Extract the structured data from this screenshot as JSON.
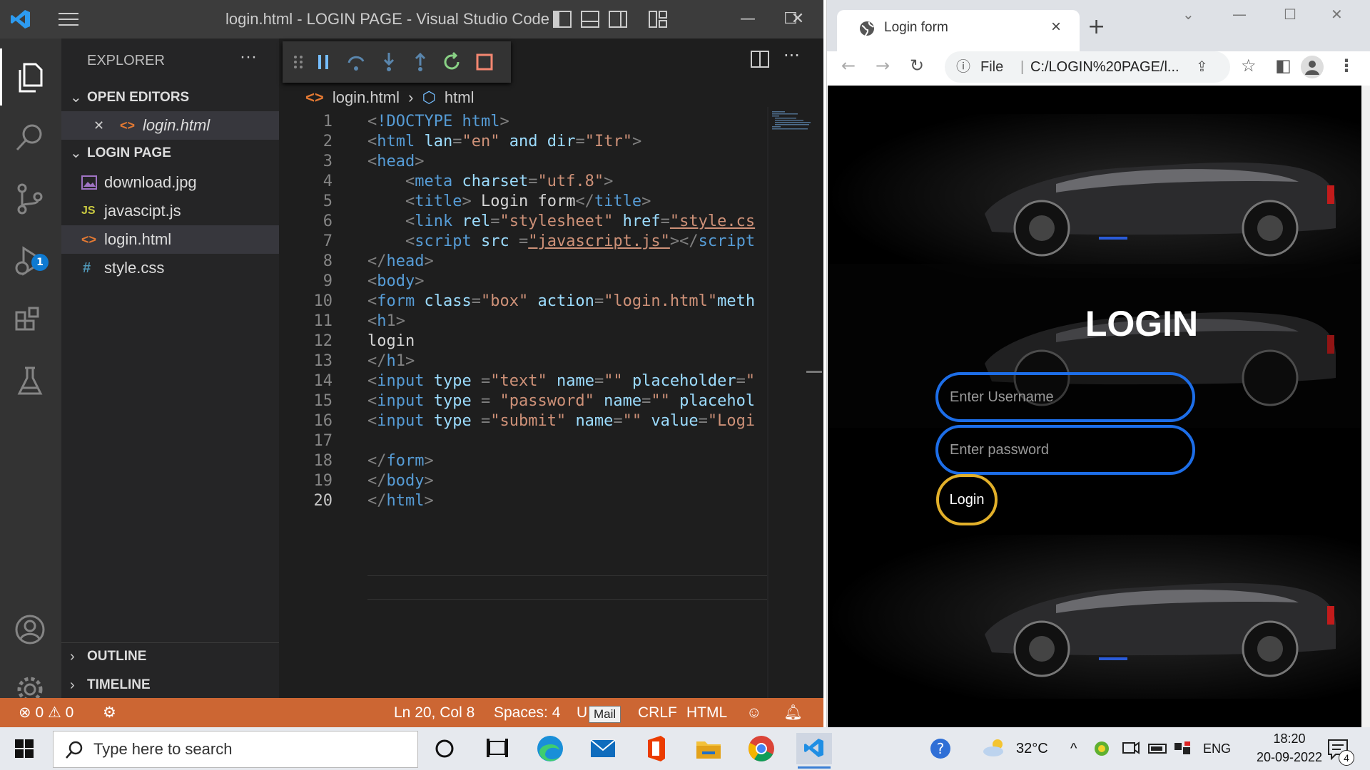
{
  "vscode": {
    "window_title": "login.html - LOGIN PAGE - Visual Studio Code",
    "explorer_title": "EXPLORER",
    "more": "···",
    "open_editors_label": "OPEN EDITORS",
    "open_editor_file": "login.html",
    "project_label": "LOGIN PAGE",
    "files": [
      {
        "name": "download.jpg",
        "icon": "image-icon",
        "color": "#a074c4"
      },
      {
        "name": "javascipt.js",
        "icon": "js-icon",
        "color": "#cbcb41"
      },
      {
        "name": "login.html",
        "icon": "html-icon",
        "color": "#e37933"
      },
      {
        "name": "style.css",
        "icon": "css-icon",
        "color": "#519aba"
      }
    ],
    "file_icons": {
      "js": "JS",
      "css": "#",
      "html": "<>"
    },
    "outline_label": "OUTLINE",
    "timeline_label": "TIMELINE",
    "debug_badge": "1",
    "breadcrumb": {
      "file": "login.html",
      "symbol": "html"
    },
    "line_numbers": [
      "1",
      "2",
      "3",
      "4",
      "5",
      "6",
      "7",
      "8",
      "9",
      "10",
      "11",
      "12",
      "13",
      "14",
      "15",
      "16",
      "17",
      "18",
      "19",
      "20"
    ],
    "code_lines": [
      "<!DOCTYPE html>",
      "<html lan=\"en\" and dir=\"Itr\">",
      "<head>",
      "    <meta charset=\"utf.8\">",
      "    <title> Login form</title>",
      "    <link rel=\"stylesheet\" href=\"style.cs",
      "    <script src =\"javascript.js\"></script",
      "</head>",
      "<body>",
      "<form class=\"box\" action=\"login.html\"meth",
      "<h1>",
      "login",
      "</h1>",
      "<input type =\"text\" name=\"\" placeholder=\"",
      "<input type = \"password\" name=\"\" placehol",
      "<input type =\"submit\" name=\"\" value=\"Logi",
      "",
      "</form>",
      "</body>",
      "</html>"
    ],
    "status": {
      "errors": "0",
      "warnings": "0",
      "position": "Ln 20, Col 8",
      "spaces": "Spaces: 4",
      "encoding_fragment": "U",
      "eol": "CRLF",
      "language": "HTML"
    },
    "tooltip": "Mail",
    "accent": "#cc6633"
  },
  "browser": {
    "tab_title": "Login form",
    "url_scheme": "File",
    "url": "C:/LOGIN%20PAGE/l...",
    "page": {
      "heading": "LOGIN",
      "username_placeholder": "Enter Username",
      "password_placeholder": "Enter password",
      "login_button": "Login"
    }
  },
  "taskbar": {
    "search_placeholder": "Type here to search",
    "weather": "32°C",
    "language": "ENG",
    "time": "18:20",
    "date": "20-09-2022",
    "notifications": "4"
  }
}
